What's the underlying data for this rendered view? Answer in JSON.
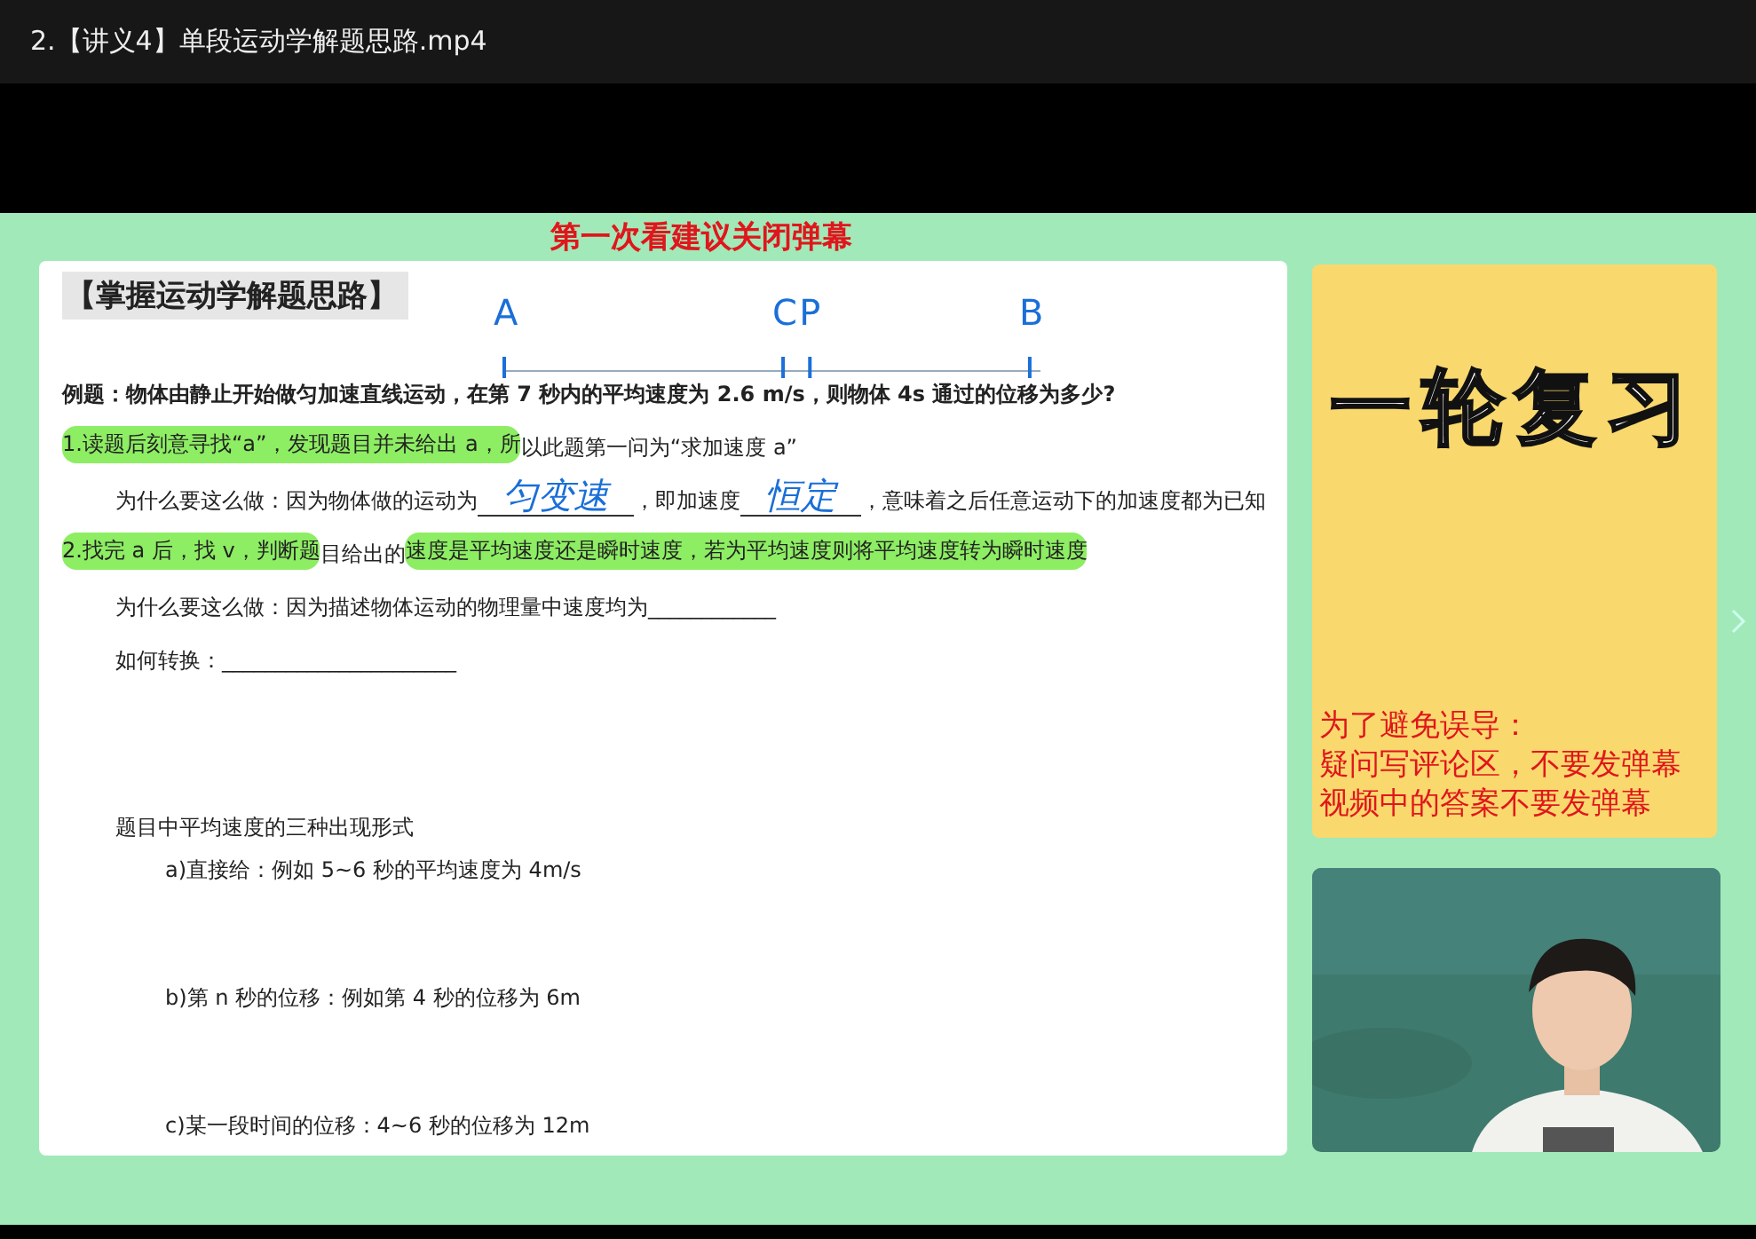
{
  "player": {
    "title": "2.【讲义4】单段运动学解题思路.mp4"
  },
  "video": {
    "banner": "第一次看建议关闭弹幕",
    "document": {
      "heading": "【掌握运动学解题思路】",
      "diagram": {
        "points": [
          {
            "label": "A"
          },
          {
            "label": "C"
          },
          {
            "label": "P"
          },
          {
            "label": "B"
          }
        ]
      },
      "lines": [
        {
          "kind": "question",
          "segments": [
            {
              "kind": "text",
              "text": "例题：物体由静止开始做匀加速直线运动，在第 7 秒内的平均速度为 2.6 m/s，则物体 4s 通过的位移为多少?",
              "highlighted": false
            }
          ]
        },
        {
          "kind": "step",
          "segments": [
            {
              "kind": "text",
              "text": "1.读题后刻意寻找“a”，发现题目并未给出 a，所",
              "highlighted": true
            },
            {
              "kind": "text",
              "text": "以此题第一问为“求加速度 a”",
              "highlighted": false
            }
          ]
        },
        {
          "kind": "detail",
          "segments": [
            {
              "kind": "text",
              "text": "为什么要这么做：因为物体做的运动为",
              "highlighted": false
            },
            {
              "kind": "blank",
              "text": "匀变速"
            },
            {
              "kind": "text",
              "text": "，即加速度",
              "highlighted": false
            },
            {
              "kind": "blank",
              "text": "恒定"
            },
            {
              "kind": "text",
              "text": "，意味着之后任意运动下的加速度都为已知",
              "highlighted": false
            }
          ]
        },
        {
          "kind": "step",
          "segments": [
            {
              "kind": "text",
              "text": "2.找完 a 后，找 v，判断题",
              "highlighted": true
            },
            {
              "kind": "text",
              "text": "目给出的",
              "highlighted": false
            },
            {
              "kind": "text",
              "text": "速度是平均速度还是瞬时速度，若为平均速度则将平均速度转为瞬时速度",
              "highlighted": true
            }
          ]
        },
        {
          "kind": "detail",
          "segments": [
            {
              "kind": "text",
              "text": "为什么要这么做：因为描述物体运动的物理量中速度均为____________",
              "highlighted": false
            }
          ]
        },
        {
          "kind": "detail",
          "segments": [
            {
              "kind": "text",
              "text": "如何转换：______________________",
              "highlighted": false
            }
          ]
        },
        {
          "kind": "subheading",
          "segments": [
            {
              "kind": "text",
              "text": "题目中平均速度的三种出现形式",
              "highlighted": false
            }
          ]
        },
        {
          "kind": "example",
          "segments": [
            {
              "kind": "text",
              "text": "a)直接给：例如 5~6 秒的平均速度为 4m/s",
              "highlighted": false
            }
          ]
        },
        {
          "kind": "example",
          "segments": [
            {
              "kind": "text",
              "text": "b)第 n 秒的位移：例如第 4 秒的位移为 6m",
              "highlighted": false
            }
          ]
        },
        {
          "kind": "example",
          "segments": [
            {
              "kind": "text",
              "text": "c)某一段时间的位移：4~6 秒的位移为 12m",
              "highlighted": false
            }
          ]
        }
      ]
    },
    "card": {
      "title": "一轮复习",
      "notice": [
        "为了避免误导：",
        "疑问写评论区，不要发弹幕",
        "视频中的答案不要发弹幕"
      ]
    }
  }
}
